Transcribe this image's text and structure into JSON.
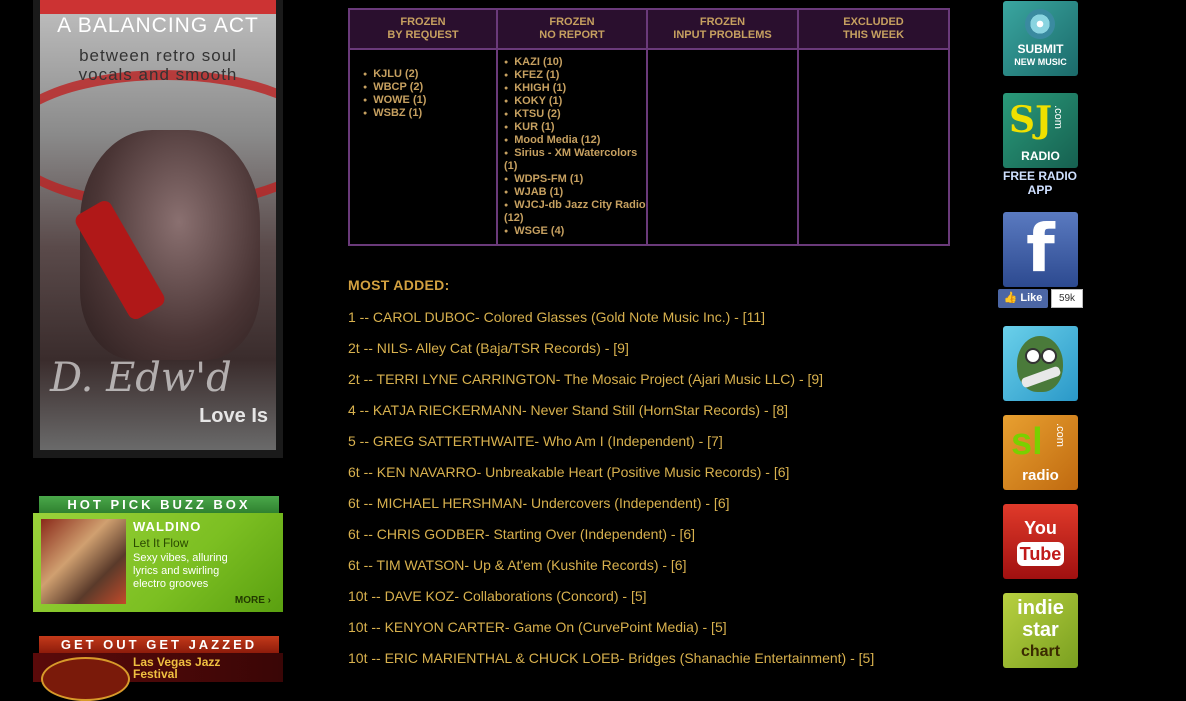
{
  "left_ad": {
    "title": "A BALANCING ACT",
    "subtitle_line1": "between retro soul",
    "subtitle_line2": "vocals and smooth",
    "signature": "D. Edw'd",
    "album": "Love Is"
  },
  "buzz_box": {
    "heading": "HOT PICK BUZZ BOX",
    "artist": "WALDINO",
    "album": "Let It Flow",
    "blurb": "Sexy vibes, alluring lyrics and swirling electro grooves",
    "more": "MORE ›"
  },
  "jazz_box": {
    "heading": "GET OUT GET JAZZED",
    "title": "Las Vegas Jazz Festival"
  },
  "frozen_table": {
    "headers": [
      "FROZEN\nBY REQUEST",
      "FROZEN\nNO REPORT",
      "FROZEN\nINPUT PROBLEMS",
      "EXCLUDED\nTHIS WEEK"
    ],
    "by_request": [
      "KJLU (2)",
      "WBCP (2)",
      "WOWE (1)",
      "WSBZ (1)"
    ],
    "no_report": [
      "KAZI (10)",
      "KFEZ (1)",
      "KHIGH (1)",
      "KOKY (1)",
      "KTSU (2)",
      "KUR (1)",
      "Mood Media (12)",
      "Sirius - XM Watercolors (1)",
      "WDPS-FM (1)",
      "WJAB (1)",
      "WJCJ-db Jazz City Radio (12)",
      "WSGE (4)"
    ],
    "input_problems": [],
    "excluded": []
  },
  "most_added": {
    "heading": "MOST ADDED:",
    "items": [
      "1 -- CAROL DUBOC- Colored Glasses (Gold Note Music Inc.) - [11]",
      "2t -- NILS- Alley Cat (Baja/TSR Records) - [9]",
      "2t -- TERRI LYNE CARRINGTON- The Mosaic Project (Ajari Music LLC) - [9]",
      "4 -- KATJA RIECKERMANN- Never Stand Still (HornStar Records) - [8]",
      "5 -- GREG SATTERTHWAITE- Who Am I (Independent) - [7]",
      "6t -- KEN NAVARRO- Unbreakable Heart (Positive Music Records) - [6]",
      "6t -- MICHAEL HERSHMAN- Undercovers (Independent) - [6]",
      "6t -- CHRIS GODBER- Starting Over (Independent) - [6]",
      "6t -- TIM WATSON- Up & At'em (Kushite Records) - [6]",
      "10t -- DAVE KOZ- Collaborations (Concord) - [5]",
      "10t -- KENYON CARTER- Game On (CurvePoint Media) - [5]",
      "10t -- ERIC MARIENTHAL & CHUCK LOEB- Bridges (Shanachie Entertainment) - [5]"
    ]
  },
  "sidebar": {
    "submit": {
      "line1": "SUBMIT",
      "line2": "NEW MUSIC"
    },
    "sj_radio": {
      "mono": "SJ",
      "dotcom": ".com",
      "radio": "RADIO",
      "caption": "FREE RADIO\nAPP"
    },
    "facebook": {
      "f": "f",
      "like": "Like",
      "count": "59k"
    },
    "sl_radio": {
      "mono": "sl",
      "dotcom": ".com",
      "radio": "radio"
    },
    "youtube": {
      "you": "You",
      "tube": "Tube"
    },
    "indie": {
      "t1": "indie",
      "t2": "star",
      "t3": "chart"
    }
  },
  "colors": {
    "background": "#000000",
    "table_border": "#6a3a7a",
    "gold_text": "#d8b14e",
    "header_bg": "#2a0f2e"
  }
}
